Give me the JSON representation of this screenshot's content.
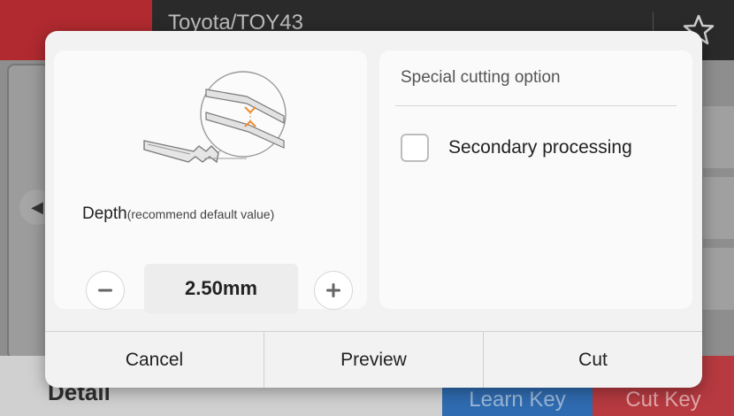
{
  "background": {
    "header_title": "Toyota/TOY43",
    "footer": {
      "detail_label": "Detail",
      "learn_key_label": "Learn Key",
      "cut_key_label": "Cut Key"
    }
  },
  "dialog": {
    "depth": {
      "label": "Depth",
      "hint": "(recommend default value)",
      "value": "2.50mm"
    },
    "special": {
      "title": "Special cutting option",
      "checkbox_label": "Secondary processing",
      "checked": false
    },
    "buttons": {
      "cancel": "Cancel",
      "preview": "Preview",
      "cut": "Cut"
    }
  },
  "colors": {
    "back_red": "#b02a30",
    "learn_blue": "#2f6bb0",
    "cut_red": "#b63a40",
    "accent_orange": "#f08a2c"
  }
}
